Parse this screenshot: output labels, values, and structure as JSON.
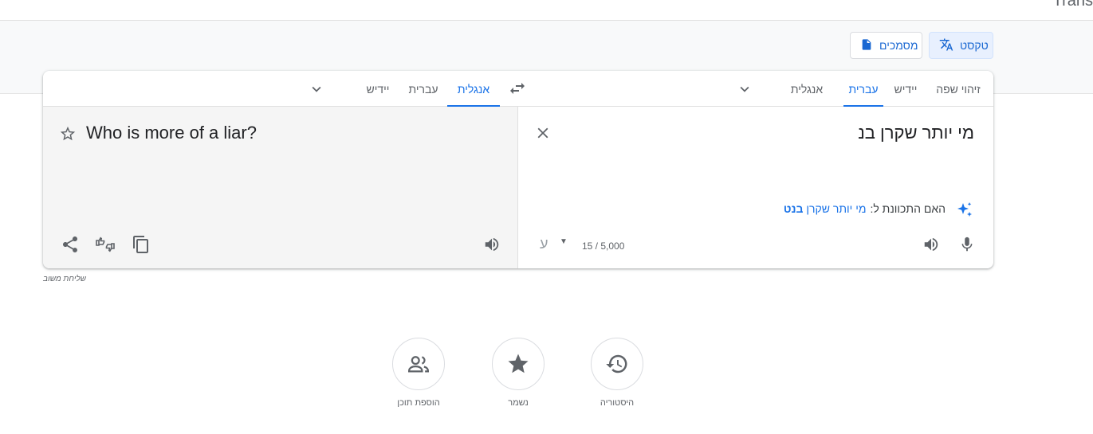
{
  "header": {
    "brand_fragment": "Trans"
  },
  "modes": {
    "text": "טקסט",
    "documents": "מסמכים"
  },
  "source_langs": {
    "detect": "זיהוי שפה",
    "yiddish": "יידיש",
    "hebrew": "עברית",
    "english": "אנגלית"
  },
  "target_langs": {
    "english": "אנגלית",
    "hebrew": "עברית",
    "yiddish": "יידיש"
  },
  "source": {
    "text": "מי יותר שקרן בנ",
    "suggestion_label": "האם התכוונת ל:",
    "suggestion_plain": "מי יותר שקרן",
    "suggestion_bold": "בנט",
    "char_count": "15 / 5,000",
    "keyboard_glyph": "ע"
  },
  "target": {
    "text": "Who is more of a liar?"
  },
  "feedback": "שליחת משוב",
  "bottom": {
    "history": "היסטוריה",
    "saved": "נשמר",
    "contribute": "הוספת תוכן"
  },
  "colors": {
    "accent": "#1a73e8",
    "icon": "#5f6368"
  }
}
